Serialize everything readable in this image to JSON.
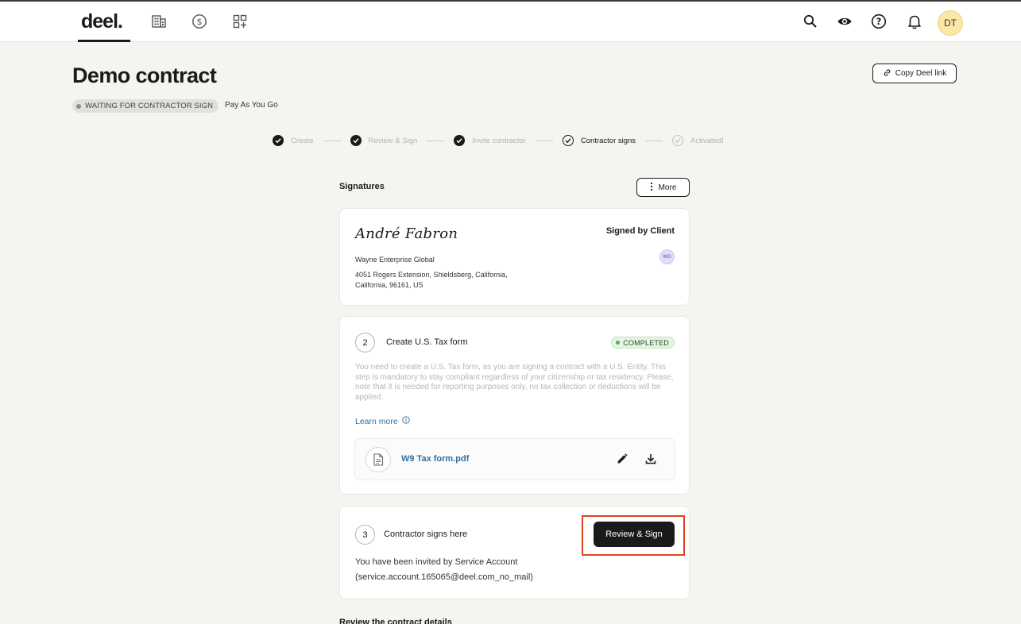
{
  "topbar": {
    "logo": "deel.",
    "nav_icons": [
      "organization-icon",
      "payments-icon",
      "apps-icon"
    ],
    "right_icons": [
      "search-icon",
      "eye-icon",
      "help-icon",
      "bell-icon"
    ],
    "avatar_initials": "DT"
  },
  "header": {
    "title": "Demo contract",
    "copy_link_label": "Copy Deel link",
    "status": "WAITING FOR CONTRACTOR SIGN",
    "plan": "Pay As You Go"
  },
  "stepper": {
    "steps": [
      {
        "label": "Create",
        "state": "done"
      },
      {
        "label": "Review & Sign",
        "state": "done"
      },
      {
        "label": "Invite contractor",
        "state": "done"
      },
      {
        "label": "Contractor signs",
        "state": "current"
      },
      {
        "label": "Activated!",
        "state": "pending"
      }
    ]
  },
  "signatures": {
    "title": "Signatures",
    "more_label": "More",
    "client_card": {
      "signature": "André Fabron",
      "signed_by_label": "Signed by Client",
      "badge": "WG",
      "company": "Wayne Enterprise Global",
      "address": "4051 Rogers Extension, Shieldsberg, California, California, 96161, US"
    },
    "tax_card": {
      "number": "2",
      "title": "Create U.S. Tax form",
      "status": "COMPLETED",
      "description": "You need to create a U.S. Tax form, as you are signing a contract with a U.S. Entity. This step is mandatory to stay compliant regardless of your citizenship or tax residency. Please, note that it is needed for reporting purposes only, no tax collection or deductions will be applied.",
      "learn_more": "Learn more",
      "file_name": "W9 Tax form.pdf"
    },
    "sign_card": {
      "number": "3",
      "title": "Contractor signs here",
      "button_label": "Review & Sign",
      "invite_line1": "You have been invited by Service Account",
      "invite_line2": "(service.account.165065@deel.com_no_mail)"
    }
  },
  "next_section_title": "Review the contract details",
  "colors": {
    "background": "#f5f4f1",
    "primary_button": "#1a1a1a",
    "link": "#2f6f9e",
    "highlight": "#e0411f",
    "avatar": "#fbe8a6",
    "completed_bg": "#e6f5e3"
  }
}
